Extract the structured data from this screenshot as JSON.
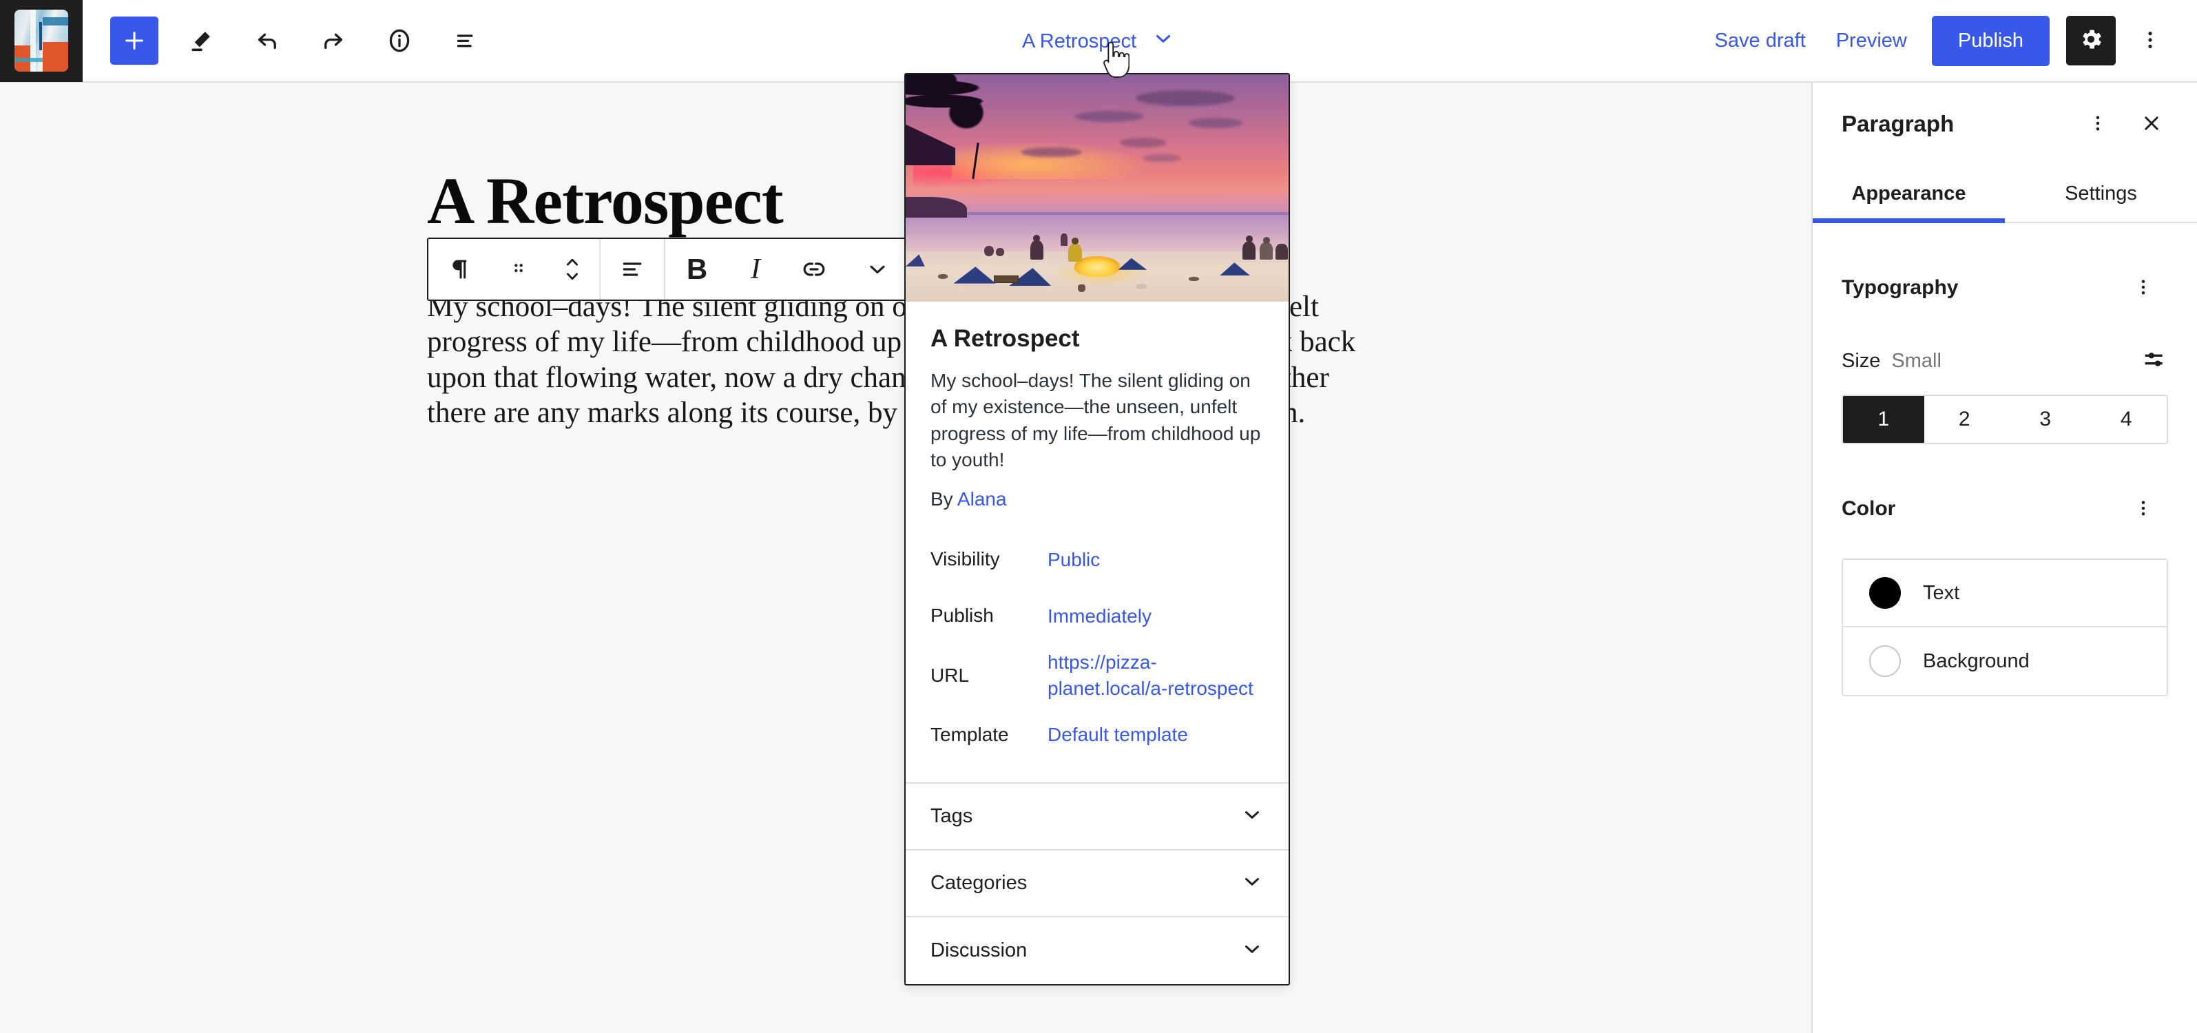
{
  "header": {
    "site_icon_name": "site-icon-thumbnail",
    "tools": [
      {
        "name": "add-block-button",
        "icon": "plus-icon",
        "label": "Add block"
      },
      {
        "name": "tools-button",
        "icon": "pencil-icon",
        "label": "Tools"
      },
      {
        "name": "undo-button",
        "icon": "undo-arrow-icon",
        "label": "Undo"
      },
      {
        "name": "redo-button",
        "icon": "redo-arrow-icon",
        "label": "Redo"
      },
      {
        "name": "details-button",
        "icon": "info-icon",
        "label": "Details"
      },
      {
        "name": "list-view-button",
        "icon": "list-view-icon",
        "label": "List View"
      }
    ],
    "document_title": "A Retrospect",
    "document_title_chevron": "chevron-down-icon",
    "save_draft_label": "Save draft",
    "preview_label": "Preview",
    "publish_label": "Publish",
    "settings_icon": "gear-icon",
    "options_icon": "kebab-vertical-icon"
  },
  "editor": {
    "post_title": "A Retrospect",
    "post_body": "My school–days! The silent gliding on of my existence—the unseen, unfelt progress of my life—from childhood up to youth! Let me think, as I look back upon that flowing water, now a dry channel overgrown with leaves, whether there are any marks along its course, by which I can remember how it ran."
  },
  "block_toolbar": {
    "items": [
      {
        "name": "block-type-paragraph-button",
        "icon": "paragraph-pilcrow-icon",
        "label": "Paragraph"
      },
      {
        "name": "drag-handle",
        "icon": "drag-dots-icon",
        "label": "Drag"
      },
      {
        "name": "move-updown-button",
        "icon": "chevron-up-down-icon",
        "label": "Move up or down"
      },
      {
        "name": "align-text-button",
        "icon": "align-text-icon",
        "label": "Align text"
      },
      {
        "name": "bold-button",
        "icon": "bold-b-icon",
        "label": "B"
      },
      {
        "name": "italic-button",
        "icon": "italic-i-icon",
        "label": "I"
      },
      {
        "name": "link-button",
        "icon": "link-chain-icon",
        "label": "Link"
      },
      {
        "name": "more-options-button",
        "icon": "chevron-down-icon",
        "label": "More"
      }
    ]
  },
  "popover": {
    "featured_image_name": "featured-image-beach-sunset",
    "title": "A Retrospect",
    "excerpt": "My school–days! The silent gliding on of my existence—the unseen, unfelt progress of my life—from childhood up to youth!",
    "by_prefix": "By",
    "author": "Alana",
    "meta": [
      {
        "label": "Visibility",
        "value": "Public"
      },
      {
        "label": "Publish",
        "value": "Immediately"
      },
      {
        "label": "URL",
        "value": "https://pizza-planet.local/a-retrospect"
      },
      {
        "label": "Template",
        "value": "Default template"
      }
    ],
    "sections": [
      {
        "label": "Tags",
        "icon": "chevron-down-icon"
      },
      {
        "label": "Categories",
        "icon": "chevron-down-icon"
      },
      {
        "label": "Discussion",
        "icon": "chevron-down-icon"
      }
    ]
  },
  "sidebar": {
    "title": "Paragraph",
    "more_icon": "kebab-vertical-icon",
    "close_icon": "close-x-icon",
    "tabs": [
      {
        "label": "Appearance",
        "active": true
      },
      {
        "label": "Settings",
        "active": false
      }
    ],
    "typography": {
      "title": "Typography",
      "more_icon": "kebab-vertical-icon",
      "size_label": "Size",
      "size_value": "Small",
      "size_tools_icon": "sliders-icon",
      "steps": [
        "1",
        "2",
        "3",
        "4"
      ],
      "active_step": "1"
    },
    "color": {
      "title": "Color",
      "more_icon": "kebab-vertical-icon",
      "items": [
        {
          "label": "Text",
          "swatch": "#000000"
        },
        {
          "label": "Background",
          "swatch": "#ffffff"
        }
      ]
    }
  },
  "colors": {
    "accent": "#3858e9",
    "dark": "#1e1e1e",
    "canvas_bg": "#f6f7f7",
    "border": "#e0e0e0"
  }
}
